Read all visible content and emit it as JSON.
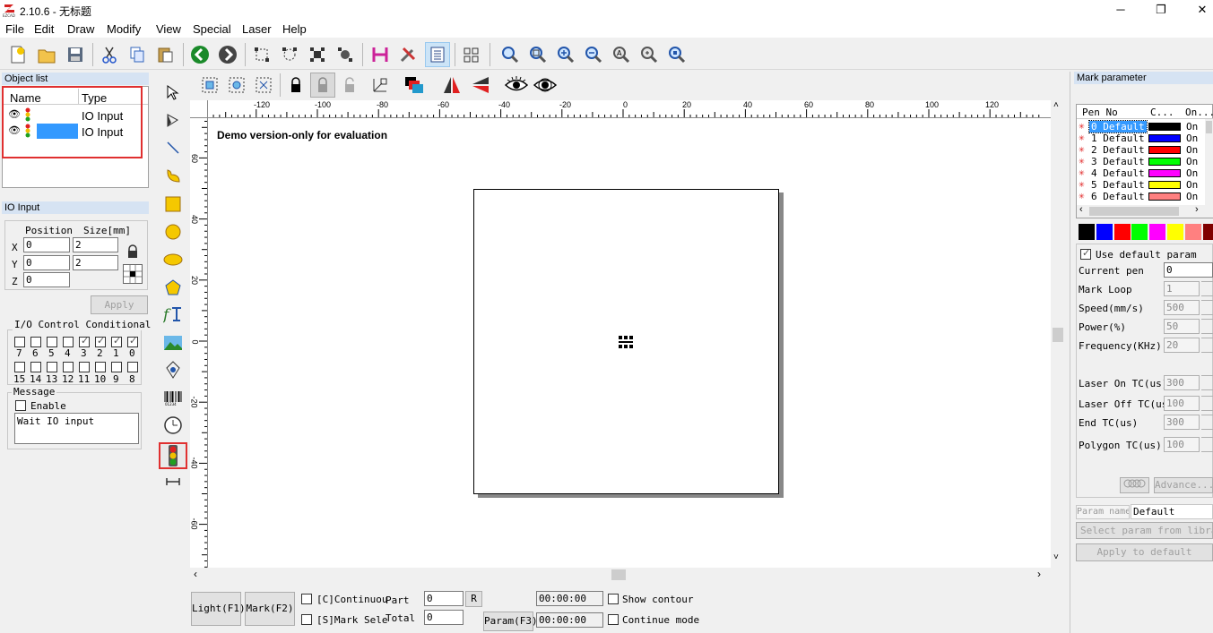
{
  "window": {
    "title": "2.10.6 - 无标题",
    "logo_text": "EZCAD"
  },
  "menu": [
    "File",
    "Edit",
    "Draw",
    "Modify",
    "View",
    "Special",
    "Laser",
    "Help"
  ],
  "object_list": {
    "title": "Object list",
    "columns": [
      "Name",
      "Type"
    ],
    "rows": [
      {
        "name": "",
        "type": "IO Input",
        "selected": false
      },
      {
        "name": "",
        "type": "IO Input",
        "selected": true
      }
    ]
  },
  "io_input": {
    "title": "IO Input",
    "position_label": "Position",
    "size_label": "Size[mm]",
    "x_label": "X",
    "y_label": "Y",
    "z_label": "Z",
    "x": "0",
    "y": "0",
    "z": "0",
    "size_x": "2",
    "size_y": "2",
    "apply_label": "Apply",
    "io_group_label": "I/O Control Conditional",
    "row1_labels": [
      "7",
      "6",
      "5",
      "4",
      "3",
      "2",
      "1",
      "0"
    ],
    "row1_checked": [
      false,
      false,
      false,
      false,
      true,
      true,
      true,
      true
    ],
    "row2_labels": [
      "15",
      "14",
      "13",
      "12",
      "11",
      "10",
      "9",
      "8"
    ],
    "row2_checked": [
      false,
      false,
      false,
      false,
      false,
      false,
      false,
      false
    ],
    "message_group_label": "Message",
    "enable_label": "Enable",
    "message_text": "Wait IO input"
  },
  "canvas": {
    "demo_text": "Demo version-only for evaluation",
    "h_ticks": [
      "-120",
      "-100",
      "-80",
      "-60",
      "-40",
      "-20",
      "0",
      "20",
      "40",
      "60",
      "80",
      "100",
      "120"
    ],
    "v_ticks": [
      "60",
      "40",
      "20",
      "0",
      "-20",
      "-40",
      "-60"
    ]
  },
  "bottom": {
    "light_label": "Light(F1)",
    "mark_label": "Mark(F2)",
    "continuous_label": "[C]Continuou",
    "mark_sel_label": "[S]Mark Sele",
    "part_label": "Part",
    "total_label": "Total",
    "part_value": "0",
    "total_value": "0",
    "r_label": "R",
    "param_label": "Param(F3)",
    "time1": "00:00:00",
    "time2": "00:00:00",
    "show_contour_label": "Show contour",
    "continue_mode_label": "Continue mode"
  },
  "mark_param": {
    "title": "Mark parameter",
    "columns": [
      "Pen No",
      "C...",
      "On..."
    ],
    "pens": [
      {
        "label": "0 Default",
        "color": "#000000",
        "on": "On",
        "selected": true
      },
      {
        "label": "1 Default",
        "color": "#0000ff",
        "on": "On",
        "selected": false
      },
      {
        "label": "2 Default",
        "color": "#ff0000",
        "on": "On",
        "selected": false
      },
      {
        "label": "3 Default",
        "color": "#00ff00",
        "on": "On",
        "selected": false
      },
      {
        "label": "4 Default",
        "color": "#ff00ff",
        "on": "On",
        "selected": false
      },
      {
        "label": "5 Default",
        "color": "#ffff00",
        "on": "On",
        "selected": false
      },
      {
        "label": "6 Default",
        "color": "#ff8080",
        "on": "On",
        "selected": false
      }
    ],
    "swatches": [
      "#000000",
      "#0000ff",
      "#ff0000",
      "#00ff00",
      "#ff00ff",
      "#ffff00",
      "#ff8080",
      "#800000"
    ],
    "use_default_label": "Use default param",
    "current_pen_label": "Current pen",
    "current_pen": "0",
    "mark_loop_label": "Mark Loop",
    "mark_loop": "1",
    "speed_label": "Speed(mm/s)",
    "speed": "500",
    "power_label": "Power(%)",
    "power": "50",
    "frequency_label": "Frequency(KHz)",
    "frequency": "20",
    "laser_on_label": "Laser On TC(us)",
    "laser_on": "300",
    "laser_off_label": "Laser Off TC(us",
    "laser_off": "100",
    "end_tc_label": "End TC(us)",
    "end_tc": "300",
    "polygon_tc_label": "Polygon TC(us)",
    "polygon_tc": "100",
    "advance_label": "Advance...",
    "param_name_label": "Param name",
    "param_name": "Default",
    "select_param_label": "Select param from library",
    "apply_default_label": "Apply to default"
  }
}
